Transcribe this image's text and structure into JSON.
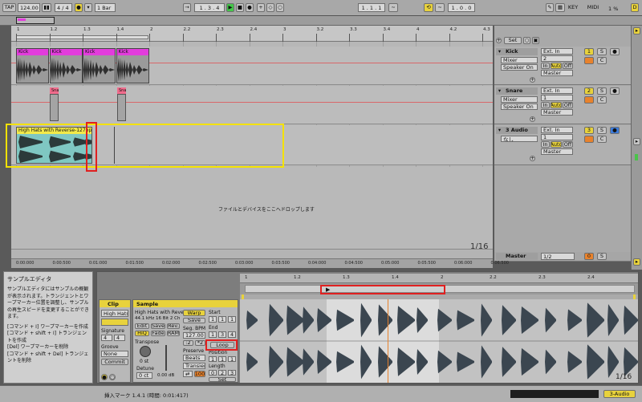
{
  "topbar": {
    "tap": "TAP",
    "tempo": "124.00",
    "meter": "4 / 4",
    "quantize": "1 Bar",
    "position": "1 . 3 . 4",
    "loop_start": "1 . 1 . 1",
    "loop_length": "1 . 0 . 0",
    "key": "KEY",
    "midi": "MIDI",
    "cpu": "1 %",
    "d": "D"
  },
  "ruler": {
    "ticks": [
      "1",
      "1.2",
      "1.3",
      "1.4",
      "2",
      "2.2",
      "2.3",
      "2.4",
      "3",
      "3.2",
      "3.3",
      "3.4",
      "4",
      "4.2",
      "4.3"
    ]
  },
  "set_label": "Set",
  "tracks": [
    {
      "name": "Kick",
      "input": "Ext. In",
      "routing": "Mixer",
      "channel": "2",
      "output": "Speaker On",
      "master": "Master",
      "in": "In",
      "auto": "Auto",
      "off": "Off",
      "number": "1",
      "s": "S",
      "c": "C",
      "color": "#e23cdc",
      "clips": [
        "Kick",
        "Kick",
        "Kick",
        "Kick"
      ]
    },
    {
      "name": "Snare",
      "input": "Ext. In",
      "routing": "Mixer",
      "channel": "1",
      "output": "Speaker On",
      "master": "Master",
      "in": "In",
      "auto": "Auto",
      "off": "Off",
      "number": "2",
      "s": "S",
      "c": "C",
      "color": "#f06c8c",
      "clips": [
        "Sna",
        "Sna"
      ]
    },
    {
      "name": "3 Audio",
      "input": "Ext. In",
      "routing": "なし",
      "channel": "1",
      "output": "",
      "master": "Master",
      "in": "In",
      "auto": "Auto",
      "off": "Off",
      "number": "3",
      "s": "S",
      "c": "C",
      "color": "#f2e94a",
      "clips": [
        "High Hats with Reverse-127bpm"
      ]
    }
  ],
  "drop_hint": "ファイルとデバイスをここへドロップします",
  "zoom": "1/16",
  "master": {
    "name": "Master",
    "input": "1/2",
    "number": "0",
    "s": "S"
  },
  "timeline": {
    "ticks": [
      "0:00:000",
      "0:00:500",
      "0:01:000",
      "0:01:500",
      "0:02:000",
      "0:02:500",
      "0:03:000",
      "0:03:500",
      "0:04:000",
      "0:04:500",
      "0:05:000",
      "0:05:500",
      "0:06:000",
      "0:06:500"
    ]
  },
  "info": {
    "title": "サンプルエディタ",
    "lines": [
      "サンプルエディタにはサンプルの概観が表示されます。トランジェントとワープマーカー位置を調整し、サンプルの再生スピードを変更することができます。",
      "[コマンド + Ⅰ] ワープマーカーを作成",
      "[コマンド + shift + Ⅰ] トランジェントを作成",
      "[Del] ワープマーカーを削除",
      "[コマンド + shift + Del] トランジェントを削除"
    ]
  },
  "clip_panel": {
    "title": "Clip",
    "name": "High Hats wi",
    "signature_label": "Signature",
    "sig_num": "4",
    "sig_den": "4",
    "groove_label": "Groove",
    "groove": "None",
    "commit": "Commit"
  },
  "sample_panel": {
    "title": "Sample",
    "file": "High Hats with Reve",
    "format": "44.1 kHz 16 Bit 2 Ch",
    "edit": "Edit",
    "save": "Save",
    "rev": "Rev.",
    "hiq": "HiQ",
    "fade": "Fade",
    "ram": "RAM",
    "transpose_label": "Transpose",
    "transpose": "0 st",
    "detune_label": "Detune",
    "detune": "0 ct",
    "gain": "0.00 dB",
    "warp": "Warp",
    "seg_bpm_label": "Seg. BPM",
    "seg_bpm": "127.00",
    "half": ":2",
    "double": "*2",
    "preserve_label": "Preserve",
    "preserve": "Beats",
    "mode": "Transients",
    "start_label": "Start",
    "end_label": "End",
    "start": [
      "1",
      "1",
      "1"
    ],
    "end": [
      "1",
      "3",
      "4"
    ],
    "loop": "Loop",
    "position_label": "Position",
    "position": [
      "1",
      "1",
      "1"
    ],
    "length_label": "Length",
    "length": [
      "0",
      "2",
      "3"
    ],
    "set": "Set",
    "value": "100"
  },
  "wave_ruler": {
    "ticks": [
      "1",
      "1.2",
      "1.3",
      "1.4",
      "2",
      "2.2",
      "2.3",
      "2.4"
    ]
  },
  "wave_zoom": "1/16",
  "status": {
    "text": "挿入マーク 1.4.1 (時間: 0:01:417)",
    "right": "3-Audio"
  }
}
